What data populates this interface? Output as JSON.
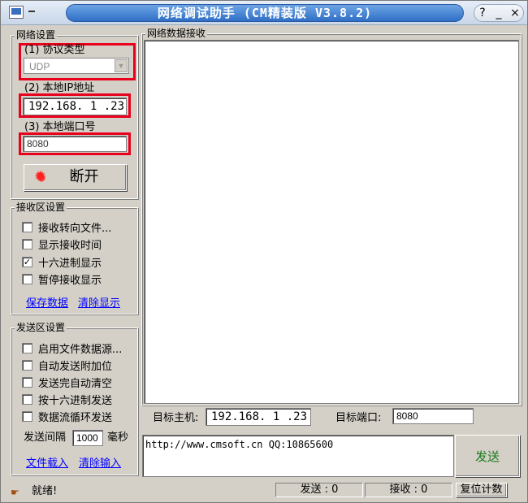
{
  "window": {
    "title": "网络调试助手 (CM精装版 V3.8.2)",
    "controls": {
      "help": "?",
      "minimize": "_",
      "close": "×"
    }
  },
  "network_settings": {
    "group_title": "网络设置",
    "protocol_label": "(1) 协议类型",
    "protocol_value": "UDP",
    "local_ip_label": "(2) 本地IP地址",
    "local_ip_value": "192.168. 1 .23",
    "local_port_label": "(3) 本地端口号",
    "local_port_value": "8080",
    "connect_button": "断开"
  },
  "receive_settings": {
    "group_title": "接收区设置",
    "options": [
      {
        "label": "接收转向文件...",
        "checked": false
      },
      {
        "label": "显示接收时间",
        "checked": false
      },
      {
        "label": "十六进制显示",
        "checked": true
      },
      {
        "label": "暂停接收显示",
        "checked": false
      }
    ],
    "save_link": "保存数据",
    "clear_link": "清除显示"
  },
  "send_settings": {
    "group_title": "发送区设置",
    "options": [
      {
        "label": "启用文件数据源...",
        "checked": false
      },
      {
        "label": "自动发送附加位",
        "checked": false
      },
      {
        "label": "发送完自动清空",
        "checked": false
      },
      {
        "label": "按十六进制发送",
        "checked": false
      },
      {
        "label": "数据流循环发送",
        "checked": false
      }
    ],
    "interval_label": "发送间隔",
    "interval_value": "1000",
    "interval_unit": "毫秒",
    "load_file_link": "文件载入",
    "clear_input_link": "清除输入"
  },
  "receive_panel": {
    "group_title": "网络数据接收"
  },
  "target": {
    "host_label": "目标主机:",
    "host_value": "192.168. 1 .23",
    "port_label": "目标端口:",
    "port_value": "8080"
  },
  "send_panel": {
    "text": "http://www.cmsoft.cn QQ:10865600",
    "send_button": "发送"
  },
  "status": {
    "ready": "就绪!",
    "sent": "发送 : 0",
    "received": "接收 : 0",
    "reset_button": "复位计数"
  },
  "colors": {
    "highlight_box": "#e8001c",
    "title_bar": "#2f6fc6",
    "send_button_text": "#1a7a1a",
    "link": "#0000ff"
  }
}
